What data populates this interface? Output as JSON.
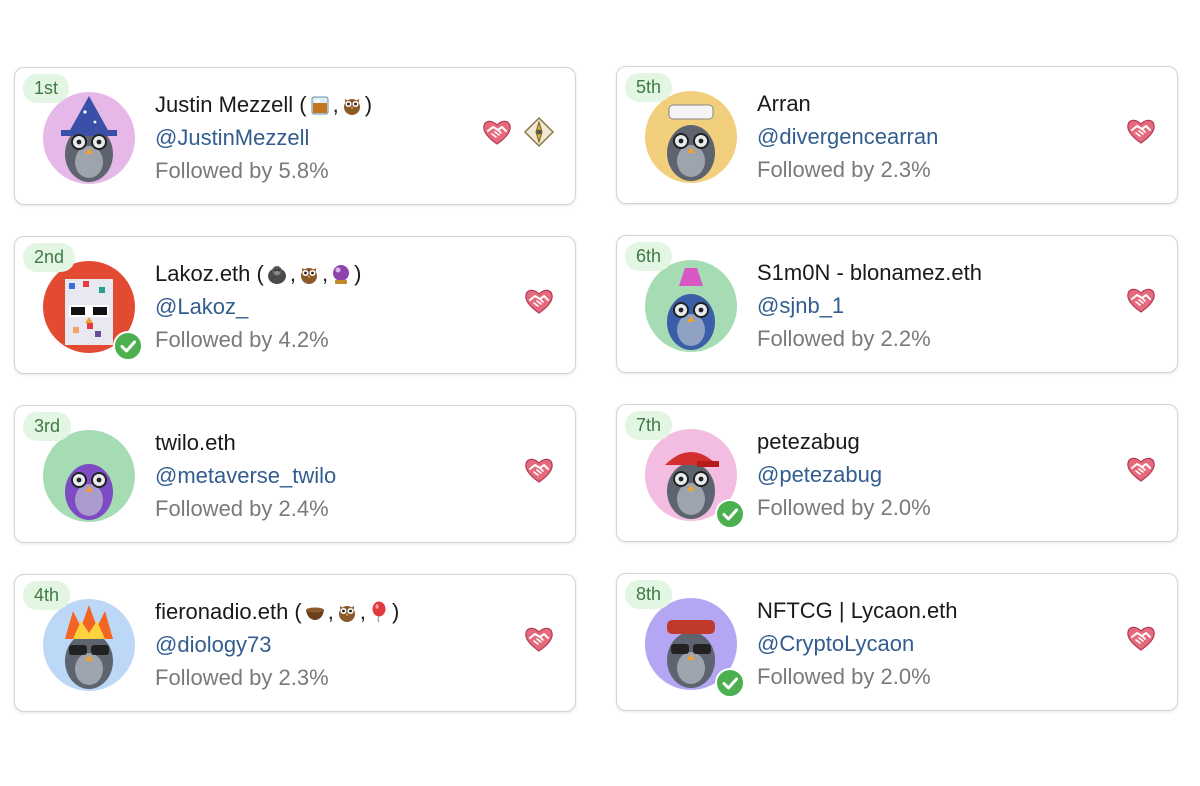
{
  "accounts": [
    {
      "rank": "1st",
      "name": "Justin Mezzell (",
      "name_end": ")",
      "emojis": [
        "whisky-glass-emoji",
        "owl-emoji"
      ],
      "handle": "@JustinMezzell",
      "followed": "Followed by 5.8%",
      "verified": false,
      "icons": [
        "handshake-icon",
        "compass-diamond-icon"
      ],
      "avatar_bg": "#e6b8e8"
    },
    {
      "rank": "5th",
      "name": "Arran",
      "name_end": "",
      "emojis": [],
      "handle": "@divergencearran",
      "followed": "Followed by 2.3%",
      "verified": false,
      "icons": [
        "handshake-icon"
      ],
      "avatar_bg": "#f2cf7c"
    },
    {
      "rank": "2nd",
      "name": "Lakoz.eth (",
      "name_end": ")",
      "emojis": [
        "gorilla-emoji",
        "owl-emoji",
        "crystal-ball-emoji"
      ],
      "handle": "@Lakoz_",
      "followed": "Followed by 4.2%",
      "verified": true,
      "icons": [
        "handshake-icon"
      ],
      "avatar_bg": "#e34a32"
    },
    {
      "rank": "6th",
      "name": "S1m0N - blonamez.eth",
      "name_end": "",
      "emojis": [],
      "handle": "@sjnb_1",
      "followed": "Followed by 2.2%",
      "verified": false,
      "icons": [
        "handshake-icon"
      ],
      "avatar_bg": "#a6dcb4"
    },
    {
      "rank": "3rd",
      "name": "twilo.eth",
      "name_end": "",
      "emojis": [],
      "handle": "@metaverse_twilo",
      "followed": "Followed by 2.4%",
      "verified": false,
      "icons": [
        "handshake-icon"
      ],
      "avatar_bg": "#a6dcb4"
    },
    {
      "rank": "7th",
      "name": "petezabug",
      "name_end": "",
      "emojis": [],
      "handle": "@petezabug",
      "followed": "Followed by 2.0%",
      "verified": true,
      "icons": [
        "handshake-icon"
      ],
      "avatar_bg": "#f2bde0"
    },
    {
      "rank": "4th",
      "name": "fieronadio.eth (",
      "name_end": ")",
      "emojis": [
        "bowl-emoji",
        "owl-emoji",
        "balloon-emoji"
      ],
      "handle": "@diology73",
      "followed": "Followed by 2.3%",
      "verified": false,
      "icons": [
        "handshake-icon"
      ],
      "avatar_bg": "#bcd8f6"
    },
    {
      "rank": "8th",
      "name": "NFTCG | Lycaon.eth",
      "name_end": "",
      "emojis": [],
      "handle": "@CryptoLycaon",
      "followed": "Followed by 2.0%",
      "verified": true,
      "icons": [
        "handshake-icon"
      ],
      "avatar_bg": "#b4a6f2"
    }
  ],
  "colors": {
    "badge_bg": "#e3f5e3",
    "badge_text": "#3e7a44",
    "handle": "#335d8f",
    "followed": "#7a7a7a",
    "verified": "#4caf50"
  }
}
